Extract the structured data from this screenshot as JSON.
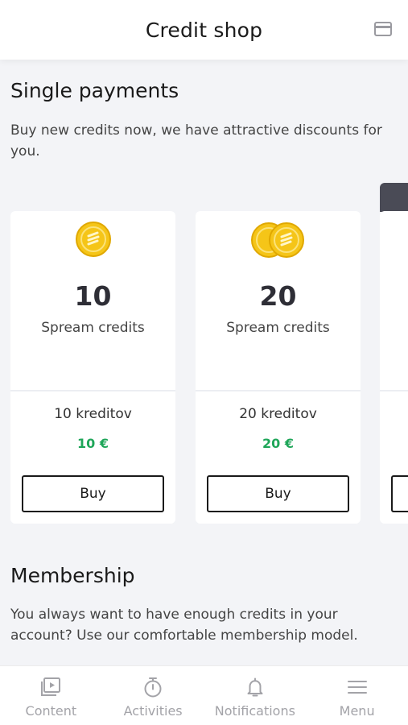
{
  "header": {
    "title": "Credit shop",
    "card_icon": "credit-card-icon"
  },
  "single_payments": {
    "title": "Single payments",
    "description": "Buy new credits now, we have attractive discounts for you."
  },
  "packages": [
    {
      "credits": "10",
      "credits_label": "Spream credits",
      "name": "10 kreditov",
      "price": "10 €",
      "buy_label": "Buy",
      "coin_count": 1
    },
    {
      "credits": "20",
      "credits_label": "Spream credits",
      "name": "20 kreditov",
      "price": "20 €",
      "buy_label": "Buy",
      "coin_count": 2
    }
  ],
  "membership": {
    "title": "Membership",
    "description": "You always want to have enough credits in your account? Use our comfortable membership model."
  },
  "bottom_nav": [
    {
      "label": "Content",
      "icon": "play-video-icon"
    },
    {
      "label": "Activities",
      "icon": "stopwatch-icon"
    },
    {
      "label": "Notifications",
      "icon": "bell-icon"
    },
    {
      "label": "Menu",
      "icon": "hamburger-menu-icon"
    }
  ],
  "colors": {
    "price_green": "#1fa659",
    "coin_gold": "#f5c518",
    "nav_gray": "#a3a3a8",
    "background": "#f3f4f7"
  }
}
